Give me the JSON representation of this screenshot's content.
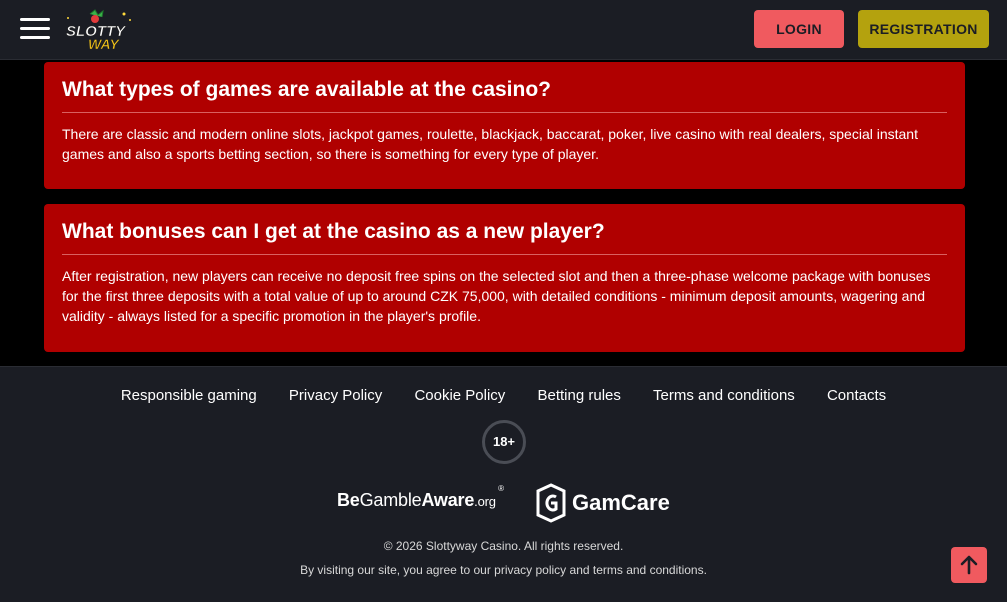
{
  "header": {
    "menu_icon": "hamburger-menu-icon",
    "logo_line1": "SLOTTY",
    "logo_line2": "WAY",
    "login_label": "LOGIN",
    "registration_label": "REGISTRATION",
    "colors": {
      "login": "#f05a5f",
      "registration": "#b4a20e",
      "bar": "#1b1d24"
    }
  },
  "faq": [
    {
      "question": "What types of games are available at the casino?",
      "answer": "There are classic and modern online slots, jackpot games, roulette, blackjack, baccarat, poker, live casino with real dealers, special instant games and also a sports betting section, so there is something for every type of player."
    },
    {
      "question": "What bonuses can I get at the casino as a new player?",
      "answer": "After registration, new players can receive no deposit free spins on the selected slot and then a three-phase welcome package with bonuses for the first three deposits with a total value of up to around CZK 75,000, with detailed conditions - minimum deposit amounts, wagering and validity - always listed for a specific promotion in the player's profile."
    }
  ],
  "footer": {
    "links": [
      "Responsible gaming",
      "Privacy Policy",
      "Cookie Policy",
      "Betting rules",
      "Terms and conditions",
      "Contacts"
    ],
    "age_badge": "18+",
    "begambleaware": {
      "be": "Be",
      "gamble": "Gamble",
      "aware": "Aware",
      "org": ".org",
      "reg": "®"
    },
    "gamcare": "GamCare",
    "copyright": "© 2026 Slottyway Casino. All rights reserved.",
    "agreement": "By visiting our site, you agree to our privacy policy and terms and conditions."
  },
  "scroll_top_icon": "arrow-up-icon",
  "colors": {
    "faq_card": "#b00000",
    "footer": "#1b1d24"
  }
}
